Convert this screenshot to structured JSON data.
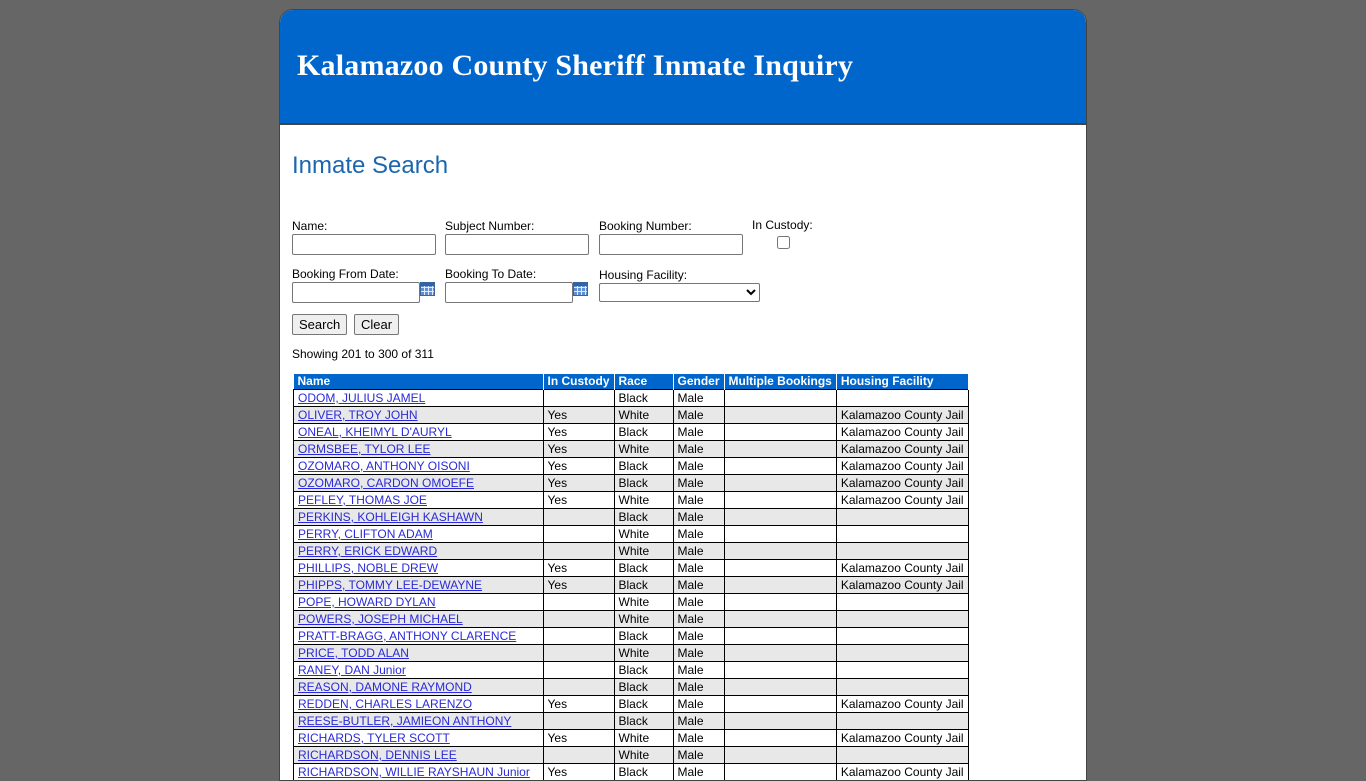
{
  "header": {
    "title": "Kalamazoo County Sheriff Inmate Inquiry"
  },
  "search": {
    "title": "Inmate Search",
    "name_label": "Name:",
    "subject_label": "Subject Number:",
    "booking_label": "Booking Number:",
    "custody_label": "In Custody:",
    "from_date_label": "Booking From Date:",
    "to_date_label": "Booking To Date:",
    "housing_label": "Housing Facility:",
    "name_value": "",
    "subject_value": "",
    "booking_value": "",
    "from_date_value": "",
    "to_date_value": "",
    "housing_value": "",
    "custody_checked": false,
    "search_button": "Search",
    "clear_button": "Clear"
  },
  "results": {
    "showing_text": "Showing 201 to 300 of 311",
    "columns": [
      "Name",
      "In Custody",
      "Race",
      "Gender",
      "Multiple Bookings",
      "Housing Facility"
    ],
    "rows": [
      {
        "name": "ODOM, JULIUS JAMEL",
        "custody": "",
        "race": "Black",
        "gender": "Male",
        "multiple": "",
        "housing": ""
      },
      {
        "name": "OLIVER, TROY JOHN",
        "custody": "Yes",
        "race": "White",
        "gender": "Male",
        "multiple": "",
        "housing": "Kalamazoo County Jail"
      },
      {
        "name": "ONEAL, KHEIMYL D'AURYL",
        "custody": "Yes",
        "race": "Black",
        "gender": "Male",
        "multiple": "",
        "housing": "Kalamazoo County Jail"
      },
      {
        "name": "ORMSBEE, TYLOR LEE",
        "custody": "Yes",
        "race": "White",
        "gender": "Male",
        "multiple": "",
        "housing": "Kalamazoo County Jail"
      },
      {
        "name": "OZOMARO, ANTHONY OISONI",
        "custody": "Yes",
        "race": "Black",
        "gender": "Male",
        "multiple": "",
        "housing": "Kalamazoo County Jail"
      },
      {
        "name": "OZOMARO, CARDON OMOEFE",
        "custody": "Yes",
        "race": "Black",
        "gender": "Male",
        "multiple": "",
        "housing": "Kalamazoo County Jail"
      },
      {
        "name": "PEFLEY, THOMAS JOE",
        "custody": "Yes",
        "race": "White",
        "gender": "Male",
        "multiple": "",
        "housing": "Kalamazoo County Jail"
      },
      {
        "name": "PERKINS, KOHLEIGH KASHAWN",
        "custody": "",
        "race": "Black",
        "gender": "Male",
        "multiple": "",
        "housing": ""
      },
      {
        "name": "PERRY, CLIFTON ADAM",
        "custody": "",
        "race": "White",
        "gender": "Male",
        "multiple": "",
        "housing": ""
      },
      {
        "name": "PERRY, ERICK EDWARD",
        "custody": "",
        "race": "White",
        "gender": "Male",
        "multiple": "",
        "housing": ""
      },
      {
        "name": "PHILLIPS, NOBLE DREW",
        "custody": "Yes",
        "race": "Black",
        "gender": "Male",
        "multiple": "",
        "housing": "Kalamazoo County Jail"
      },
      {
        "name": "PHIPPS, TOMMY LEE-DEWAYNE",
        "custody": "Yes",
        "race": "Black",
        "gender": "Male",
        "multiple": "",
        "housing": "Kalamazoo County Jail"
      },
      {
        "name": "POPE, HOWARD DYLAN",
        "custody": "",
        "race": "White",
        "gender": "Male",
        "multiple": "",
        "housing": ""
      },
      {
        "name": "POWERS, JOSEPH MICHAEL",
        "custody": "",
        "race": "White",
        "gender": "Male",
        "multiple": "",
        "housing": ""
      },
      {
        "name": "PRATT-BRAGG, ANTHONY CLARENCE",
        "custody": "",
        "race": "Black",
        "gender": "Male",
        "multiple": "",
        "housing": ""
      },
      {
        "name": "PRICE, TODD ALAN",
        "custody": "",
        "race": "White",
        "gender": "Male",
        "multiple": "",
        "housing": ""
      },
      {
        "name": "RANEY, DAN Junior",
        "custody": "",
        "race": "Black",
        "gender": "Male",
        "multiple": "",
        "housing": ""
      },
      {
        "name": "REASON, DAMONE RAYMOND",
        "custody": "",
        "race": "Black",
        "gender": "Male",
        "multiple": "",
        "housing": ""
      },
      {
        "name": "REDDEN, CHARLES LARENZO",
        "custody": "Yes",
        "race": "Black",
        "gender": "Male",
        "multiple": "",
        "housing": "Kalamazoo County Jail"
      },
      {
        "name": "REESE-BUTLER, JAMIEON ANTHONY",
        "custody": "",
        "race": "Black",
        "gender": "Male",
        "multiple": "",
        "housing": ""
      },
      {
        "name": "RICHARDS, TYLER SCOTT",
        "custody": "Yes",
        "race": "White",
        "gender": "Male",
        "multiple": "",
        "housing": "Kalamazoo County Jail"
      },
      {
        "name": "RICHARDSON, DENNIS LEE",
        "custody": "",
        "race": "White",
        "gender": "Male",
        "multiple": "",
        "housing": ""
      },
      {
        "name": "RICHARDSON, WILLIE RAYSHAUN Junior",
        "custody": "Yes",
        "race": "Black",
        "gender": "Male",
        "multiple": "",
        "housing": "Kalamazoo County Jail"
      }
    ]
  },
  "colors": {
    "background": "#666666",
    "banner": "#0066cc",
    "title_blue": "#1a66b0",
    "alt_row": "#e8e8e8"
  },
  "icons": {
    "calendar": "calendar-icon"
  }
}
